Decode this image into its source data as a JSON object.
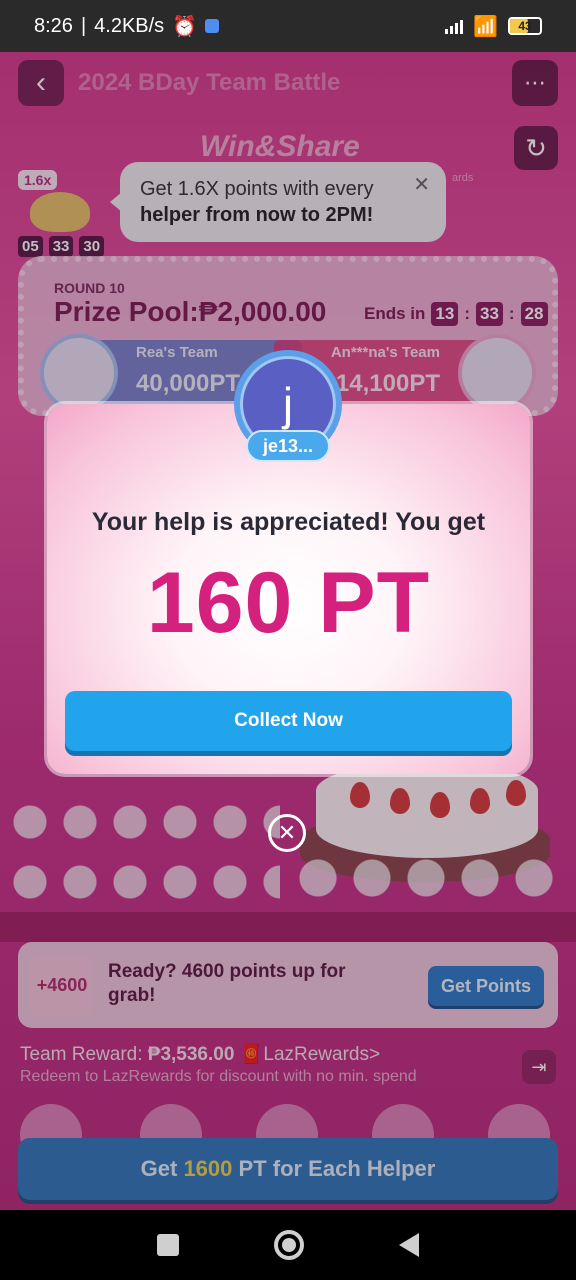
{
  "status_bar": {
    "time": "8:26",
    "speed": "4.2KB/s",
    "battery": "43"
  },
  "header": {
    "title": "2024 BDay Team Battle",
    "banner": "Win&Share"
  },
  "tooltip": {
    "multiplier_badge": "1.6x",
    "timer": [
      "05",
      "33",
      "30"
    ],
    "text_plain": "Get 1.6X points with every",
    "text_bold": "helper from now to 2PM!",
    "trailing": "ards"
  },
  "battle": {
    "round": "ROUND 10",
    "prize_pool": "Prize Pool:₱2,000.00",
    "ends_in_label": "Ends in",
    "ends_in": [
      "13",
      "33",
      "28"
    ],
    "team_a": {
      "name": "Rea's Team",
      "points": "40,000PT"
    },
    "team_b": {
      "name": "An***na's Team",
      "points": "14,100PT"
    }
  },
  "modal": {
    "avatar_letter": "j",
    "user_name": "je13...",
    "message": "Your help is appreciated! You get",
    "points": "160 PT",
    "collect_label": "Collect Now"
  },
  "points_card": {
    "badge": "+4600",
    "text": "Ready? 4600 points up for grab!",
    "button": "Get Points"
  },
  "reward": {
    "label": "Team Reward: ",
    "amount": "₱3,536.00",
    "link": "LazRewards>",
    "sub": "Redeem to LazRewards for discount with no min. spend"
  },
  "bottom_button": {
    "prefix": "Get ",
    "highlight": "1600",
    "suffix": " PT for Each Helper"
  },
  "colors": {
    "accent_pink": "#d4217e",
    "collect_blue": "#22a4ec"
  }
}
